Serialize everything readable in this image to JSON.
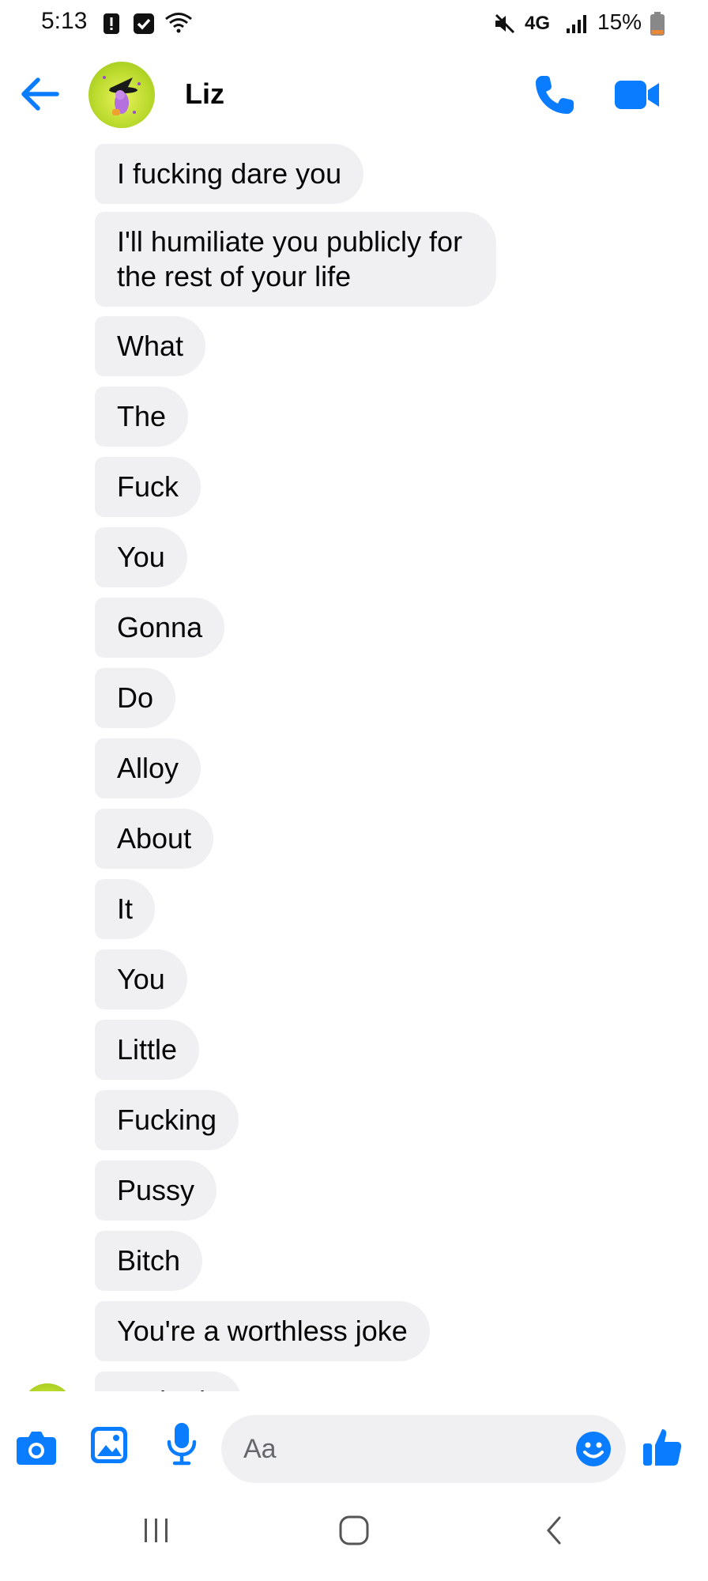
{
  "status_bar": {
    "time": "5:13",
    "network": "4G",
    "battery": "15%"
  },
  "header": {
    "contact_name": "Liz"
  },
  "messages": [
    {
      "text": "I fucking dare you"
    },
    {
      "text": "I'll humiliate you publicly for the rest of your life"
    },
    {
      "text": "What"
    },
    {
      "text": "The"
    },
    {
      "text": "Fuck"
    },
    {
      "text": "You"
    },
    {
      "text": "Gonna"
    },
    {
      "text": "Do"
    },
    {
      "text": "Alloy"
    },
    {
      "text": "About"
    },
    {
      "text": "It"
    },
    {
      "text": "You"
    },
    {
      "text": "Little"
    },
    {
      "text": "Fucking"
    },
    {
      "text": "Pussy"
    },
    {
      "text": "Bitch"
    },
    {
      "text": "You're a worthless joke"
    },
    {
      "text": "Pathetic"
    }
  ],
  "composer": {
    "placeholder": "Aa"
  },
  "colors": {
    "accent": "#0a7cff",
    "bubble": "#f0f0f3",
    "text": "#050505"
  },
  "icons": {
    "back": "arrow-left-icon",
    "call": "phone-icon",
    "video": "video-camera-icon",
    "camera": "camera-icon",
    "gallery": "image-icon",
    "mic": "microphone-icon",
    "emoji": "smiley-icon",
    "like": "thumbs-up-icon"
  }
}
